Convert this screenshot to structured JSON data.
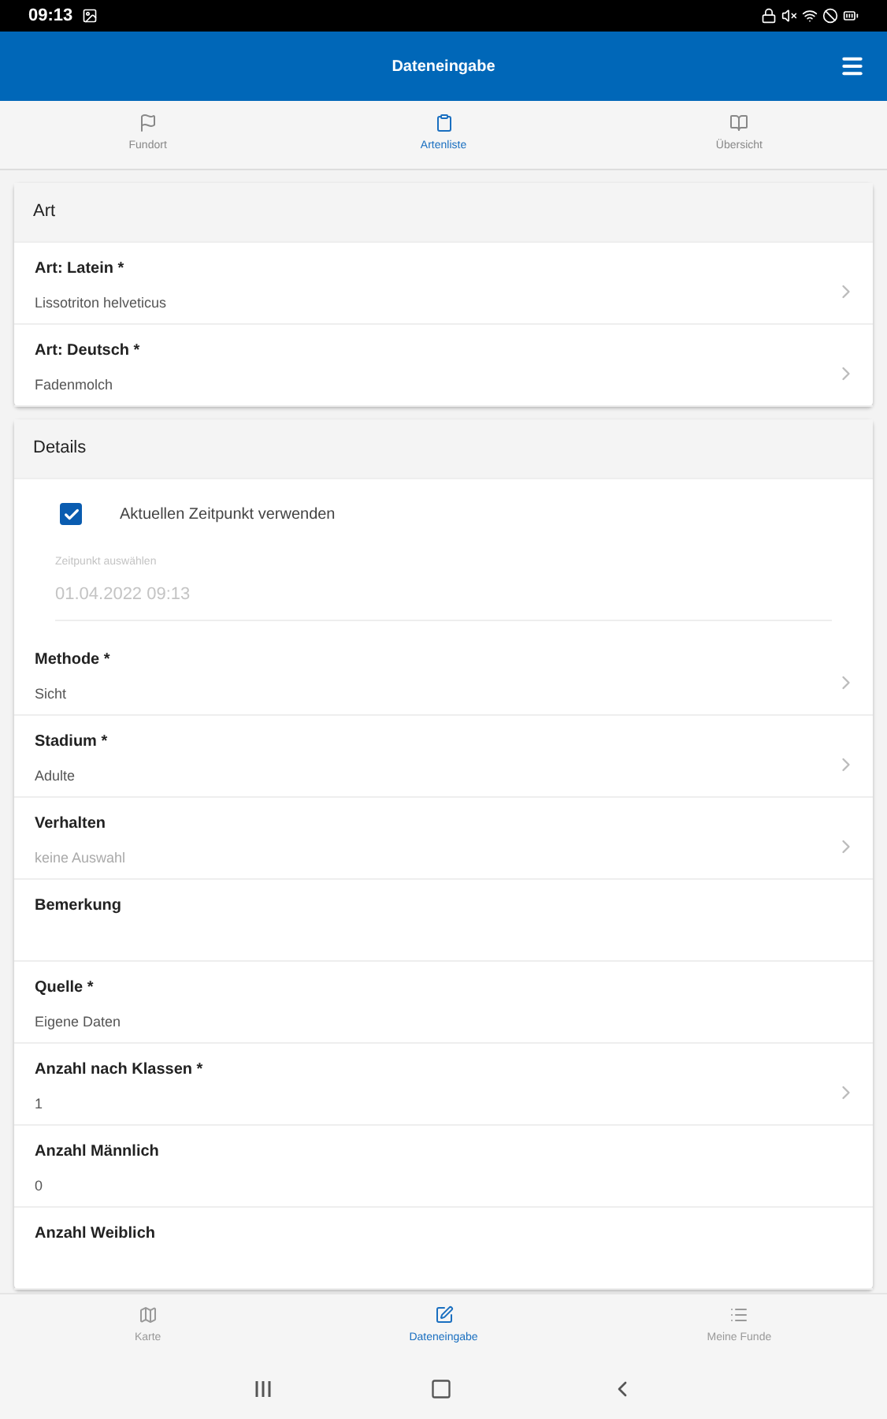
{
  "status_bar": {
    "time": "09:13"
  },
  "header": {
    "title": "Dateneingabe"
  },
  "top_tabs": [
    {
      "label": "Fundort",
      "selected": false
    },
    {
      "label": "Artenliste",
      "selected": true
    },
    {
      "label": "Übersicht",
      "selected": false
    }
  ],
  "sections": [
    {
      "title": "Art",
      "rows": [
        {
          "kind": "select",
          "label": "Art: Latein *",
          "value": "Lissotriton helveticus"
        },
        {
          "kind": "select",
          "label": "Art: Deutsch *",
          "value": "Fadenmolch"
        }
      ]
    },
    {
      "title": "Details",
      "rows": [
        {
          "kind": "checkbox",
          "label": "Aktuellen Zeitpunkt verwenden",
          "checked": true
        },
        {
          "kind": "datetime",
          "label": "Zeitpunkt auswählen",
          "value": "01.04.2022 09:13",
          "disabled": true
        },
        {
          "kind": "select",
          "label": "Methode *",
          "value": "Sicht"
        },
        {
          "kind": "select",
          "label": "Stadium *",
          "value": "Adulte"
        },
        {
          "kind": "select",
          "label": "Verhalten",
          "placeholder": "keine Auswahl"
        },
        {
          "kind": "text",
          "label": "Bemerkung"
        },
        {
          "kind": "text",
          "label": "Quelle *",
          "value": "Eigene Daten"
        },
        {
          "kind": "select",
          "label": "Anzahl nach Klassen *",
          "value": "1"
        },
        {
          "kind": "text",
          "label": "Anzahl Männlich",
          "value": "0"
        },
        {
          "kind": "text",
          "label": "Anzahl Weiblich"
        }
      ]
    }
  ],
  "bottom_nav": [
    {
      "label": "Karte",
      "selected": false
    },
    {
      "label": "Dateneingabe",
      "selected": true
    },
    {
      "label": "Meine Funde",
      "selected": false
    }
  ]
}
